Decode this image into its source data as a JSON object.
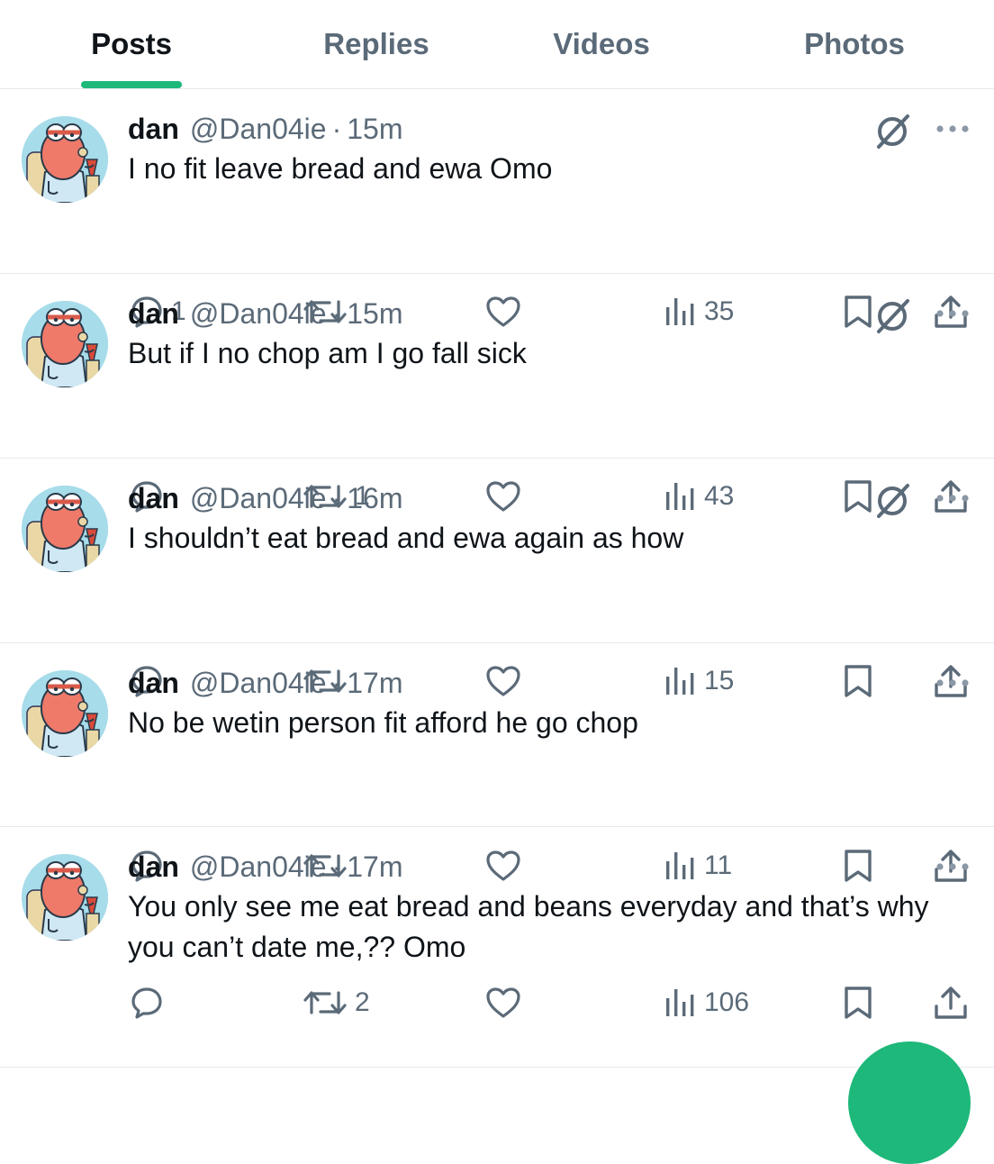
{
  "tabs": [
    {
      "label": "Posts",
      "active": true
    },
    {
      "label": "Replies",
      "active": false
    },
    {
      "label": "Videos",
      "active": false
    },
    {
      "label": "Photos",
      "active": false
    }
  ],
  "accent_color": "#1db87a",
  "posts": [
    {
      "name": "dan",
      "handle": "@Dan04ie",
      "separator": "·",
      "time": "15m",
      "text": "I no fit leave bread and ewa Omo",
      "grok": true,
      "replies": "1",
      "reposts": "",
      "likes": "",
      "views": "35"
    },
    {
      "name": "dan",
      "handle": "@Dan04ie",
      "separator": "·",
      "time": "15m",
      "text": "But if I no chop am I go fall sick",
      "grok": true,
      "replies": "",
      "reposts": "1",
      "likes": "",
      "views": "43"
    },
    {
      "name": "dan",
      "handle": "@Dan04ie",
      "separator": "·",
      "time": "16m",
      "text": "I shouldn’t eat bread and ewa again as how",
      "grok": true,
      "replies": "",
      "reposts": "",
      "likes": "",
      "views": "15"
    },
    {
      "name": "dan",
      "handle": "@Dan04ie",
      "separator": "·",
      "time": "17m",
      "text": "No be wetin person fit afford he go chop",
      "grok": false,
      "replies": "",
      "reposts": "",
      "likes": "",
      "views": "11"
    },
    {
      "name": "dan",
      "handle": "@Dan04ie",
      "separator": "·",
      "time": "17m",
      "text": "You only see me eat bread and beans everyday and that’s why you can’t date me,?? Omo",
      "grok": false,
      "replies": "",
      "reposts": "2",
      "likes": "",
      "views": "106"
    }
  ],
  "icons": {
    "reply": "reply-icon",
    "repost": "repost-icon",
    "like": "heart-icon",
    "views": "views-icon",
    "bookmark": "bookmark-icon",
    "share": "share-icon",
    "grok": "grok-icon",
    "more": "more-icon"
  }
}
